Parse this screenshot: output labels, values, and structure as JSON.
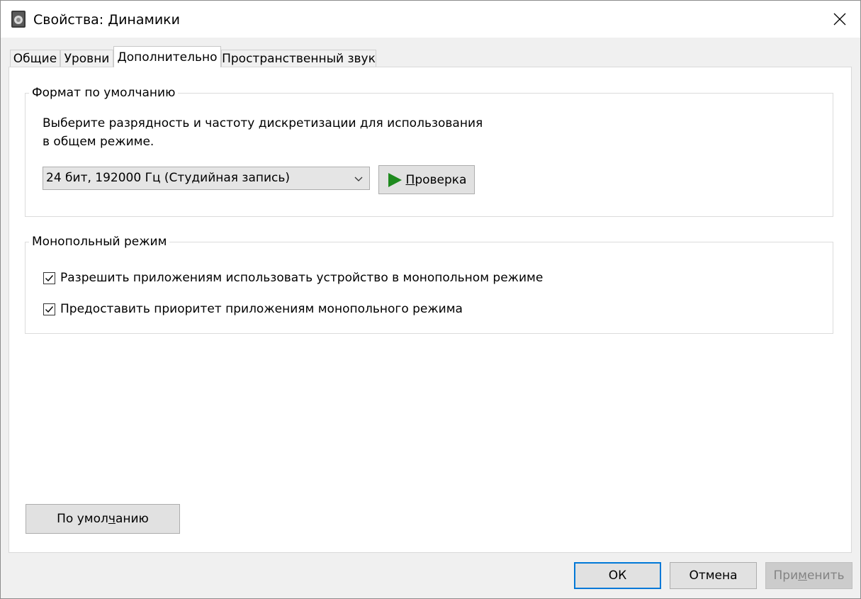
{
  "window": {
    "title": "Свойства: Динамики"
  },
  "tabs": [
    {
      "label": "Общие"
    },
    {
      "label": "Уровни"
    },
    {
      "label": "Дополнительно",
      "active": true
    },
    {
      "label": "Пространственный звук"
    }
  ],
  "default_format": {
    "legend": "Формат по умолчанию",
    "description_line1": "Выберите разрядность и частоту дискретизации для использования",
    "description_line2": "в общем режиме.",
    "format_value": "24 бит, 192000 Гц (Студийная запись)",
    "test_button": {
      "mnemonic": "П",
      "rest": "роверка"
    }
  },
  "exclusive_mode": {
    "legend": "Монопольный режим",
    "options": [
      {
        "label": "Разрешить приложениям использовать устройство в монопольном режиме",
        "checked": true
      },
      {
        "label": "Предоставить приоритет приложениям монопольного режима",
        "checked": true
      }
    ]
  },
  "restore_defaults": {
    "pre": "По умол",
    "mnemonic": "ч",
    "post": "анию"
  },
  "footer": {
    "ok": "ОК",
    "cancel": "Отмена",
    "apply": {
      "pre": "При",
      "mnemonic": "м",
      "post": "енить"
    }
  },
  "colors": {
    "accent": "#0078d7",
    "play_green": "#1e8a1e",
    "disabled_text": "#838383"
  }
}
